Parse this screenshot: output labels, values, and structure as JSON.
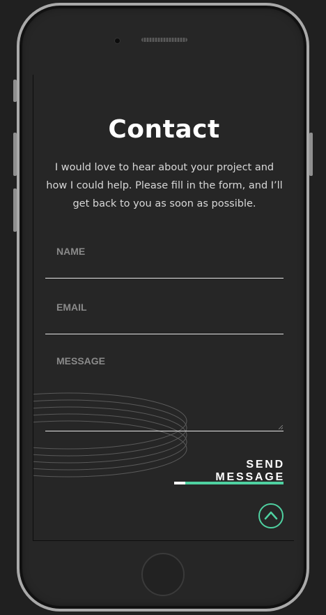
{
  "contact": {
    "title": "Contact",
    "intro": "I would love to hear about your project and how I could help. Please fill in the form, and I’ll get back to you as soon as possible."
  },
  "form": {
    "name_placeholder": "NAME",
    "email_placeholder": "EMAIL",
    "message_placeholder": "MESSAGE",
    "send_label": "SEND MESSAGE"
  },
  "colors": {
    "accent": "#4fd1a1",
    "background": "#262626",
    "text": "#ffffff",
    "placeholder": "#8a8a8a"
  },
  "icons": {
    "scroll_top": "chevron-up-icon"
  }
}
